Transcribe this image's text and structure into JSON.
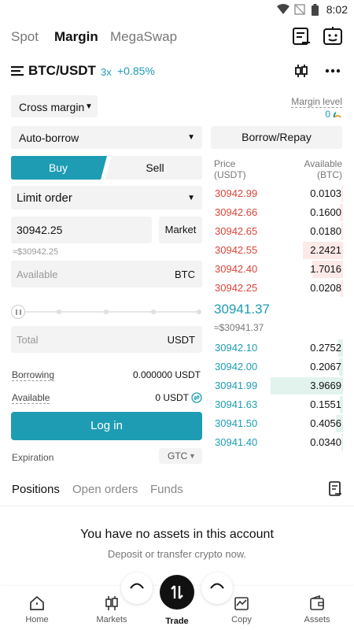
{
  "status": {
    "time": "8:02"
  },
  "top_tabs": [
    {
      "label": "Spot",
      "active": false
    },
    {
      "label": "Margin",
      "active": true
    },
    {
      "label": "MegaSwap",
      "active": false
    }
  ],
  "pair": {
    "symbol": "BTC/USDT",
    "leverage": "3x",
    "change": "+0.85%"
  },
  "margin_mode": {
    "label": "Cross margin"
  },
  "margin_level": {
    "label": "Margin level",
    "value": "0"
  },
  "borrow_mode": {
    "label": "Auto-borrow"
  },
  "borrow_repay_button": "Borrow/Repay",
  "side": {
    "buy": "Buy",
    "sell": "Sell",
    "active": "buy"
  },
  "order_type": {
    "label": "Limit order"
  },
  "price_input": {
    "value": "30942.25",
    "market_label": "Market",
    "approx": "≈$30942.25"
  },
  "amount_input": {
    "placeholder": "Available",
    "unit": "BTC"
  },
  "total_input": {
    "placeholder": "Total",
    "unit": "USDT"
  },
  "borrowing": {
    "label": "Borrowing",
    "value": "0.000000 USDT"
  },
  "available": {
    "label": "Available",
    "value": "0 USDT"
  },
  "login_button": "Log in",
  "expiration": {
    "label": "Expiration",
    "value": "GTC"
  },
  "orderbook": {
    "price_header": "Price",
    "price_unit": "(USDT)",
    "amount_header": "Available",
    "amount_unit": "(BTC)",
    "asks": [
      {
        "price": "30942.99",
        "amount": "0.0103",
        "depth": 0.02
      },
      {
        "price": "30942.66",
        "amount": "0.1600",
        "depth": 0.04
      },
      {
        "price": "30942.65",
        "amount": "0.0180",
        "depth": 0.02
      },
      {
        "price": "30942.55",
        "amount": "2.2421",
        "depth": 0.55
      },
      {
        "price": "30942.40",
        "amount": "1.7016",
        "depth": 0.42
      },
      {
        "price": "30942.25",
        "amount": "0.0208",
        "depth": 0.03
      }
    ],
    "last_price": "30941.37",
    "last_price_usd": "≈$30941.37",
    "bids": [
      {
        "price": "30942.10",
        "amount": "0.2752",
        "depth": 0.07
      },
      {
        "price": "30942.00",
        "amount": "0.2067",
        "depth": 0.05
      },
      {
        "price": "30941.99",
        "amount": "3.9669",
        "depth": 1.0
      },
      {
        "price": "30941.63",
        "amount": "0.1551",
        "depth": 0.04
      },
      {
        "price": "30941.50",
        "amount": "0.4056",
        "depth": 0.1
      },
      {
        "price": "30941.40",
        "amount": "0.0340",
        "depth": 0.02
      }
    ]
  },
  "position_tabs": [
    {
      "label": "Positions",
      "active": true
    },
    {
      "label": "Open orders",
      "active": false
    },
    {
      "label": "Funds",
      "active": false
    }
  ],
  "empty_state": {
    "title": "You have no assets in this account",
    "subtitle": "Deposit or transfer crypto now."
  },
  "bottom_nav": [
    {
      "label": "Home",
      "icon": "home-icon"
    },
    {
      "label": "Markets",
      "icon": "candlestick-icon"
    },
    {
      "label": "Trade",
      "icon": "trade-icon"
    },
    {
      "label": "Copy",
      "icon": "copy-trade-icon"
    },
    {
      "label": "Assets",
      "icon": "wallet-icon"
    }
  ],
  "colors": {
    "accent": "#1e9cb3",
    "ask": "#d9453b",
    "ask_bg": "#fde9e7",
    "bid_bg": "#e2f3ee"
  }
}
